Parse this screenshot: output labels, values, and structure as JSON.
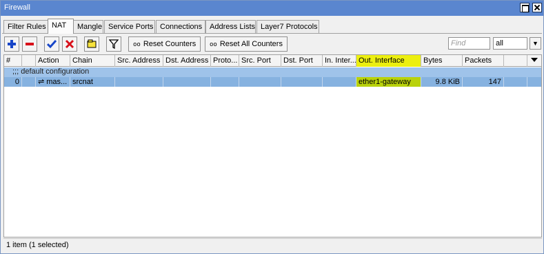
{
  "window": {
    "title": "Firewall"
  },
  "tabs": [
    {
      "label": "Filter Rules",
      "active": false
    },
    {
      "label": "NAT",
      "active": true
    },
    {
      "label": "Mangle",
      "active": false
    },
    {
      "label": "Service Ports",
      "active": false
    },
    {
      "label": "Connections",
      "active": false
    },
    {
      "label": "Address Lists",
      "active": false
    },
    {
      "label": "Layer7 Protocols",
      "active": false
    }
  ],
  "toolbar": {
    "icons": [
      "add-icon",
      "remove-icon",
      "enable-icon",
      "disable-icon",
      "comment-icon",
      "filter-icon"
    ],
    "reset_counters": "Reset Counters",
    "reset_all_counters": "Reset All Counters",
    "counter_glyph": "oo",
    "find_placeholder": "Find",
    "select_value": "all"
  },
  "table": {
    "columns": [
      "#",
      "",
      "Action",
      "Chain",
      "Src. Address",
      "Dst. Address",
      "Proto...",
      "Src. Port",
      "Dst. Port",
      "In. Inter...",
      "Out. Interface",
      "Bytes",
      "Packets",
      ""
    ],
    "highlighted_column": "Out. Interface",
    "comment_row": ";;; default configuration",
    "rows": [
      {
        "num": "0",
        "flag": "",
        "action": "⇌ mas...",
        "chain": "srcnat",
        "src_address": "",
        "dst_address": "",
        "protocol": "",
        "src_port": "",
        "dst_port": "",
        "in_interface": "",
        "out_interface": "ether1-gateway",
        "bytes": "9.8 KiB",
        "packets": "147"
      }
    ]
  },
  "status": {
    "text": "1 item (1 selected)"
  },
  "colors": {
    "titlebar": "#5a86cf",
    "selected_row": "#86b2e0",
    "comment_row": "#9fc3ea",
    "highlight": "#ecef10"
  }
}
